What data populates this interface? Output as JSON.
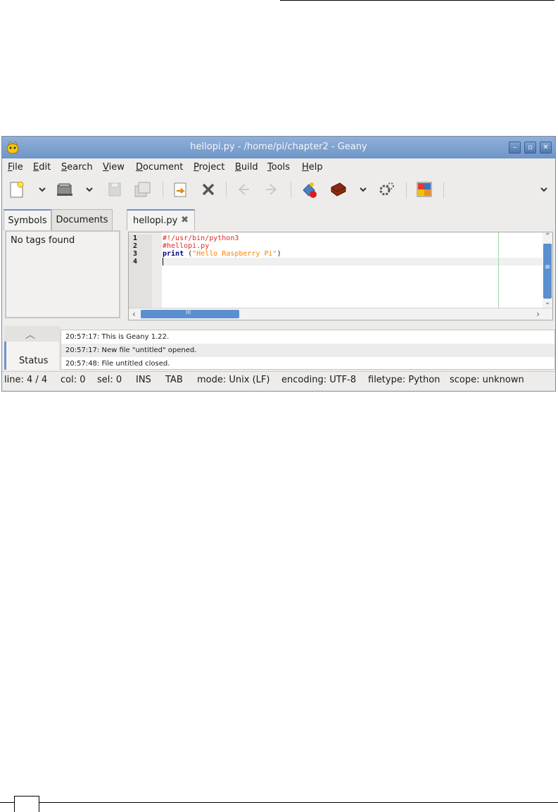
{
  "window": {
    "title": "hellopi.py - /home/pi/chapter2 - Geany",
    "controls": {
      "minimize": "–",
      "maximize": "▫",
      "close": "✕"
    }
  },
  "menu": [
    {
      "mnemonic": "F",
      "rest": "ile"
    },
    {
      "mnemonic": "E",
      "rest": "dit"
    },
    {
      "mnemonic": "S",
      "rest": "earch"
    },
    {
      "mnemonic": "V",
      "rest": "iew"
    },
    {
      "mnemonic": "D",
      "rest": "ocument"
    },
    {
      "mnemonic": "P",
      "rest": "roject"
    },
    {
      "mnemonic": "B",
      "rest": "uild"
    },
    {
      "mnemonic": "T",
      "rest": "ools"
    },
    {
      "mnemonic": "H",
      "rest": "elp"
    }
  ],
  "toolbar": {
    "icons": [
      "new-file-icon",
      "open-file-icon",
      "save-icon",
      "save-all-icon",
      "revert-icon",
      "close-icon",
      "back-icon",
      "forward-icon",
      "compile-icon",
      "build-icon",
      "execute-icon",
      "color-chooser-icon"
    ]
  },
  "sidebar": {
    "tabs": [
      "Symbols",
      "Documents"
    ],
    "empty_text": "No tags found"
  },
  "editor": {
    "tab_label": "hellopi.py",
    "tab_close": "✖",
    "line_numbers": [
      "1",
      "2",
      "3",
      "4"
    ],
    "lines": {
      "line1": "#!/usr/bin/python3",
      "line2": "#hellopi.py",
      "line3_keyword": "print",
      "line3_space": " (",
      "line3_string": "\"Hello Raspberry Pi\"",
      "line3_end": ")"
    },
    "scroll": {
      "up": "⌃",
      "down": "⌄",
      "left": "‹",
      "right": "›",
      "hgrip": "III",
      "vgrip": "≡"
    }
  },
  "messages": {
    "collapse_glyph": "︿",
    "tab_label": "Status",
    "items": [
      "20:57:17: This is Geany 1.22.",
      "20:57:17: New file \"untitled\" opened.",
      "20:57:48: File untitled closed."
    ]
  },
  "statusbar": {
    "line": "line: 4 / 4",
    "col": "col: 0",
    "sel": "sel: 0",
    "ins": "INS",
    "tab": "TAB",
    "mode": "mode: Unix (LF)",
    "encoding": "encoding: UTF-8",
    "filetype": "filetype: Python",
    "scope": "scope: unknown"
  },
  "colors": {
    "titlebar": "#6f95c7",
    "comment": "#e0271f",
    "keyword": "#00007f",
    "string": "#ff8000",
    "accent": "#5a8fd0"
  }
}
